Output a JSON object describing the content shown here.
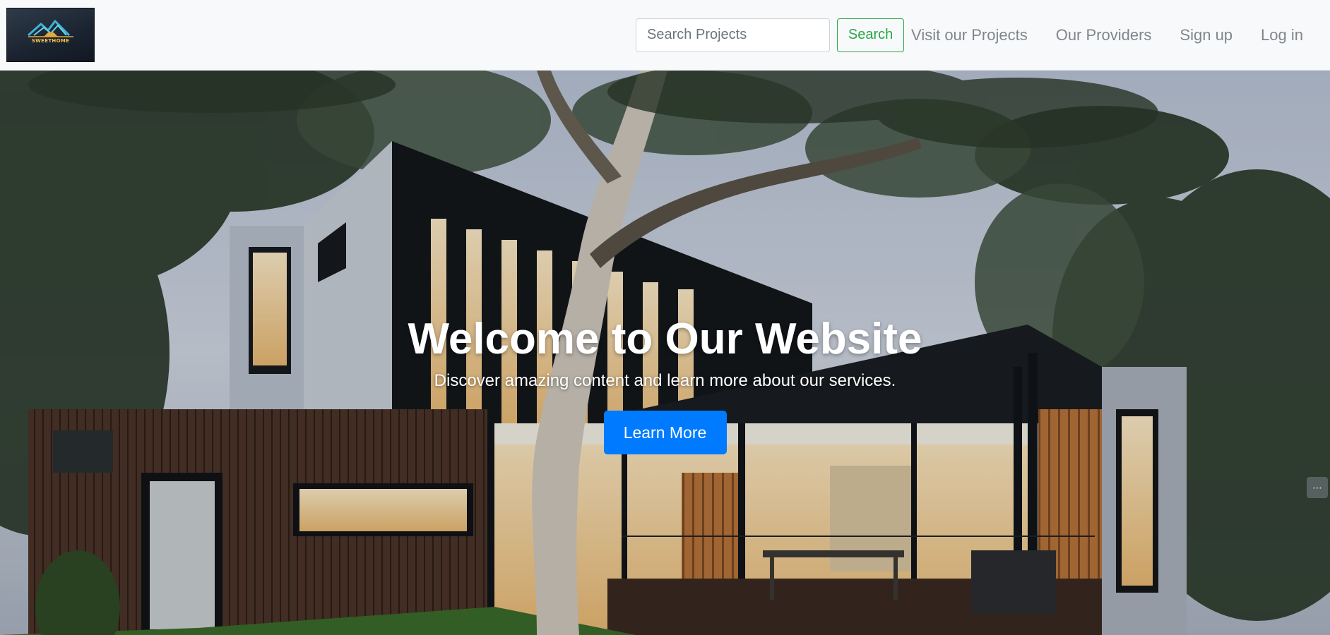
{
  "brand": {
    "logo_text": "SWEETHOME",
    "logo_icon": "house-roof-icon"
  },
  "nav": {
    "search_placeholder": "Search Projects",
    "search_value": "",
    "search_button": "Search",
    "links": [
      {
        "label": "Visit our Projects"
      },
      {
        "label": "Our Providers"
      },
      {
        "label": "Sign up"
      },
      {
        "label": "Log in"
      }
    ]
  },
  "hero": {
    "title": "Welcome to Our Website",
    "subtitle": "Discover amazing content and learn more about our services.",
    "button": "Learn More",
    "background_image": "modern-house-photo"
  },
  "widget": {
    "icon": "chat-icon"
  },
  "colors": {
    "navbar_bg": "#f8f9fa",
    "search_button": "#28a745",
    "nav_link": "#80868c",
    "primary_button": "#007bff"
  }
}
